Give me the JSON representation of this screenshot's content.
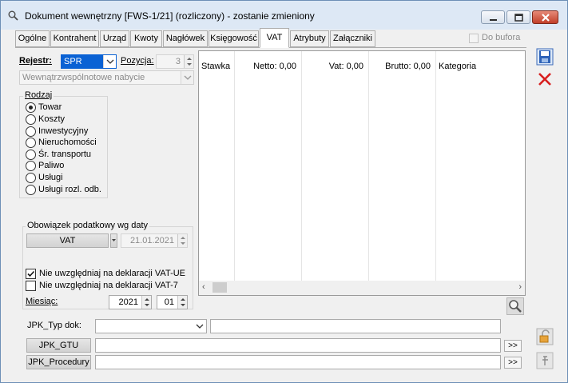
{
  "window": {
    "title": "Dokument wewnętrzny [FWS-1/21] (rozliczony) - zostanie zmieniony"
  },
  "tabs": [
    {
      "label": "Ogólne",
      "active": false
    },
    {
      "label": "Kontrahent",
      "active": false
    },
    {
      "label": "Urząd",
      "active": false
    },
    {
      "label": "Kwoty",
      "active": false
    },
    {
      "label": "Nagłówek",
      "active": false
    },
    {
      "label": "Księgowość",
      "active": false
    },
    {
      "label": "VAT",
      "active": true
    },
    {
      "label": "Atrybuty",
      "active": false
    },
    {
      "label": "Załączniki",
      "active": false
    }
  ],
  "do_bufora": {
    "label": "Do bufora",
    "checked": false
  },
  "rejestr": {
    "label": "Rejestr:",
    "value": "SPR",
    "highlight_color": "#0a62d4"
  },
  "pozycja": {
    "label": "Pozycja:",
    "value": "3"
  },
  "transaction_type": {
    "value": "Wewnątrzwspólnotowe nabycie"
  },
  "rodzaj": {
    "title": "Rodzaj",
    "options": [
      {
        "label": "Towar",
        "selected": true
      },
      {
        "label": "Koszty",
        "selected": false
      },
      {
        "label": "Inwestycyjny",
        "selected": false
      },
      {
        "label": "Nieruchomości",
        "selected": false
      },
      {
        "label": "Śr. transportu",
        "selected": false
      },
      {
        "label": "Paliwo",
        "selected": false
      },
      {
        "label": "Usługi",
        "selected": false
      },
      {
        "label": "Usługi rozl. odb.",
        "selected": false
      }
    ]
  },
  "obowiazek": {
    "title": "Obowiązek podatkowy wg daty",
    "type_value": "VAT",
    "date_value": "21.01.2021"
  },
  "checks": [
    {
      "label": "Nie uwzględniaj na deklaracji VAT-UE",
      "checked": true
    },
    {
      "label": "Nie uwzględniaj na deklaracji VAT-7",
      "checked": false
    }
  ],
  "miesiac": {
    "label": "Miesiąc:",
    "year": "2021",
    "month": "01"
  },
  "grid": {
    "columns": [
      {
        "label": "Stawka"
      },
      {
        "label": "Netto: 0,00"
      },
      {
        "label": "Vat: 0,00"
      },
      {
        "label": "Brutto: 0,00"
      },
      {
        "label": "Kategoria"
      }
    ]
  },
  "jpk": {
    "typ_label": "JPK_Typ dok:",
    "typ_value": "",
    "typ_text": "",
    "gtu_button": "JPK_GTU",
    "gtu_value": "",
    "gtu_more": ">>",
    "procedury_button": "JPK_Procedury",
    "procedury_value": "",
    "procedury_more": ">>"
  },
  "icons": {
    "save": "floppy-disk-icon",
    "cancel": "red-x-icon",
    "search": "magnifier-icon",
    "lock": "padlock-icon",
    "pin": "pin-icon"
  }
}
